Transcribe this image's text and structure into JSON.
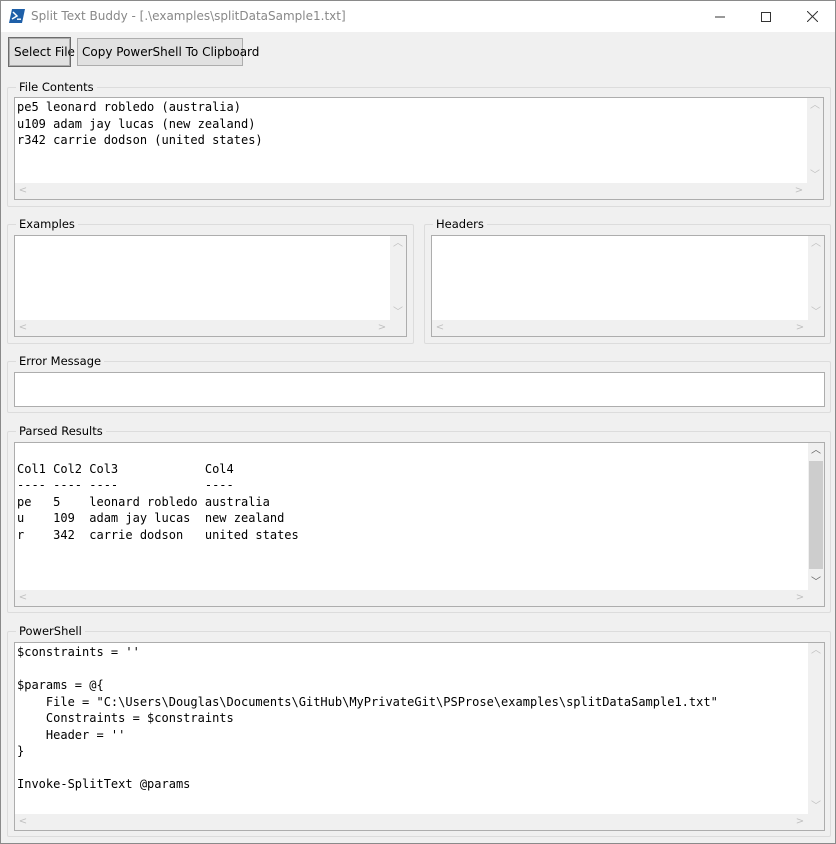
{
  "window": {
    "title": "Split Text Buddy - [.\\examples\\splitDataSample1.txt]",
    "controls": {
      "minimize": "minimize-icon",
      "maximize": "maximize-icon",
      "close": "close-icon"
    }
  },
  "toolbar": {
    "select_file_label": "Select File",
    "copy_label": "Copy PowerShell To Clipboard"
  },
  "file_contents": {
    "label": "File Contents",
    "text": "pe5 leonard robledo (australia)\nu109 adam jay lucas (new zealand)\nr342 carrie dodson (united states)"
  },
  "examples": {
    "label": "Examples",
    "text": ""
  },
  "headers": {
    "label": "Headers",
    "text": ""
  },
  "error": {
    "label": "Error Message",
    "text": ""
  },
  "parsed": {
    "label": "Parsed Results",
    "text": "\nCol1 Col2 Col3            Col4\n---- ---- ----            ----\npe   5    leonard robledo australia\nu    109  adam jay lucas  new zealand\nr    342  carrie dodson   united states"
  },
  "powershell": {
    "label": "PowerShell",
    "text": "$constraints = ''\n\n$params = @{\n    File = \"C:\\Users\\Douglas\\Documents\\GitHub\\MyPrivateGit\\PSProse\\examples\\splitDataSample1.txt\"\n    Constraints = $constraints\n    Header = ''\n}\n\nInvoke-SplitText @params"
  },
  "colors": {
    "accent": "#1e5fa8",
    "control_face": "#e1e1e1",
    "border": "#adadad"
  }
}
